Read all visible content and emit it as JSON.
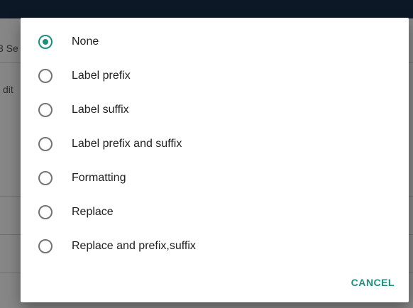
{
  "background": {
    "partial_texts": [
      "3 Se",
      "dit"
    ]
  },
  "dialog": {
    "options": [
      {
        "label": "None",
        "checked": true
      },
      {
        "label": "Label prefix",
        "checked": false
      },
      {
        "label": "Label suffix",
        "checked": false
      },
      {
        "label": "Label prefix and suffix",
        "checked": false
      },
      {
        "label": "Formatting",
        "checked": false
      },
      {
        "label": "Replace",
        "checked": false
      },
      {
        "label": "Replace and prefix,suffix",
        "checked": false
      }
    ],
    "cancel_label": "CANCEL"
  },
  "colors": {
    "accent": "#1e8e7e",
    "header": "#16283f"
  }
}
